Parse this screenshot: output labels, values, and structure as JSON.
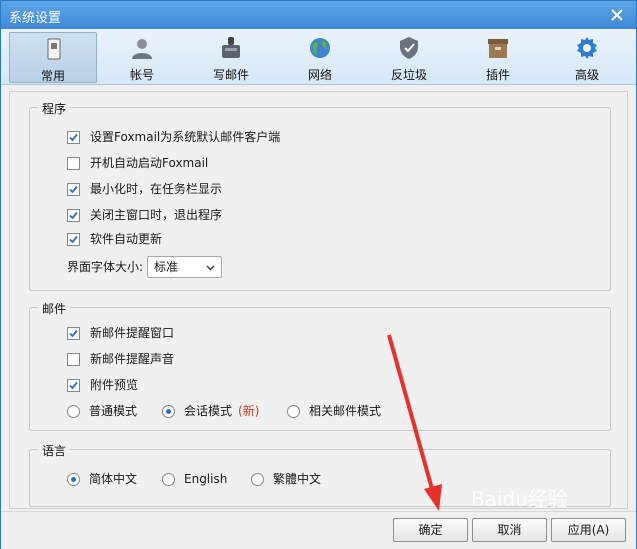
{
  "window": {
    "title": "系统设置"
  },
  "toolbar": {
    "items": [
      {
        "label": "常用",
        "icon": "general-icon",
        "active": true
      },
      {
        "label": "帐号",
        "icon": "account-icon",
        "active": false
      },
      {
        "label": "写邮件",
        "icon": "compose-icon",
        "active": false
      },
      {
        "label": "网络",
        "icon": "network-globe-icon",
        "active": false
      },
      {
        "label": "反垃圾",
        "icon": "antispam-shield-icon",
        "active": false
      },
      {
        "label": "插件",
        "icon": "plugin-box-icon",
        "active": false
      },
      {
        "label": "高级",
        "icon": "advanced-gear-icon",
        "active": false
      }
    ]
  },
  "program": {
    "title": "程序",
    "options": [
      {
        "label": "设置Foxmail为系统默认邮件客户端",
        "checked": true
      },
      {
        "label": "开机自动启动Foxmail",
        "checked": false
      },
      {
        "label": "最小化时，在任务栏显示",
        "checked": true
      },
      {
        "label": "关闭主窗口时，退出程序",
        "checked": true
      },
      {
        "label": "软件自动更新",
        "checked": true
      }
    ],
    "font_size_label": "界面字体大小:",
    "font_size_value": "标准"
  },
  "mail": {
    "title": "邮件",
    "options": [
      {
        "label": "新邮件提醒窗口",
        "checked": true
      },
      {
        "label": "新邮件提醒声音",
        "checked": false
      },
      {
        "label": "附件预览",
        "checked": true
      }
    ],
    "modes": [
      {
        "label": "普通模式",
        "selected": false
      },
      {
        "label": "会话模式",
        "selected": true,
        "tag": "(新)"
      },
      {
        "label": "相关邮件模式",
        "selected": false
      }
    ]
  },
  "language": {
    "title": "语言",
    "options": [
      {
        "label": "简体中文",
        "selected": true
      },
      {
        "label": "English",
        "selected": false
      },
      {
        "label": "繁體中文",
        "selected": false
      }
    ]
  },
  "footer": {
    "ok_label": "确定",
    "cancel_label": "取消",
    "apply_label": "应用(A)"
  },
  "colors": {
    "accent": "#2d6fc2",
    "arrow": "#e8302a",
    "title_bar": "#4a93de"
  },
  "watermark": "Baidu经验"
}
